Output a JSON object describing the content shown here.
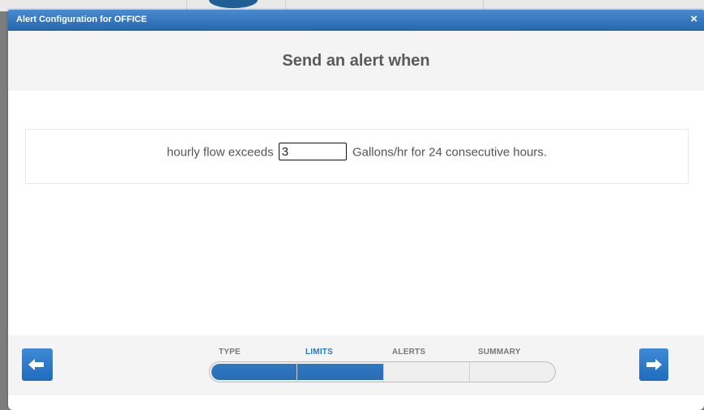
{
  "dialog": {
    "title": "Alert Configuration for OFFICE",
    "close_glyph": "×"
  },
  "header": {
    "heading": "Send an alert when"
  },
  "condition": {
    "prefix": "hourly flow exceeds",
    "value": "3",
    "suffix": "Gallons/hr for 24 consecutive hours."
  },
  "wizard": {
    "steps": [
      {
        "label": "TYPE",
        "state": "complete"
      },
      {
        "label": "LIMITS",
        "state": "active"
      },
      {
        "label": "ALERTS",
        "state": "pending"
      },
      {
        "label": "SUMMARY",
        "state": "pending"
      }
    ],
    "current_step": 2,
    "total_steps": 4,
    "progress_fraction": 0.5
  },
  "nav": {
    "back_icon": "arrow-left-icon",
    "next_icon": "arrow-right-icon"
  },
  "colors": {
    "accent": "#2a78c6",
    "titlebar": "#2e70b7"
  }
}
